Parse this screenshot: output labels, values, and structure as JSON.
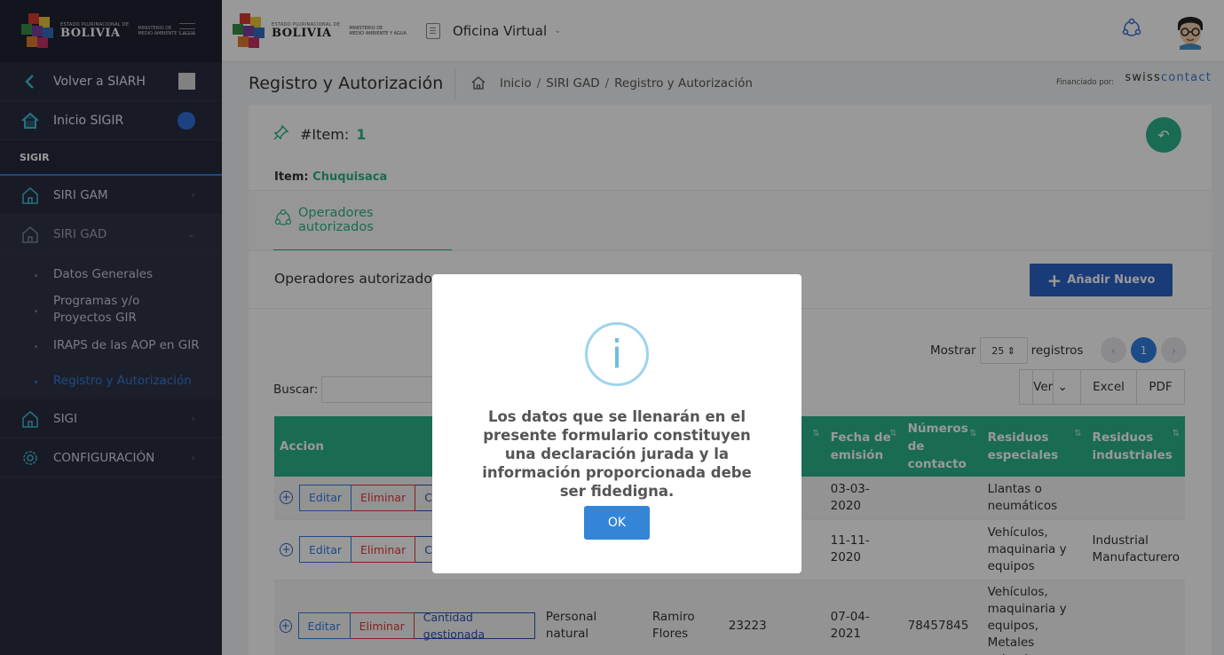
{
  "brand": {
    "state_small": "ESTADO PLURINACIONAL DE",
    "country": "BOLIVIA",
    "ministry_l1": "MINISTERIO DE",
    "ministry_l2": "MEDIO AMBIENTE Y AGUA"
  },
  "sidebar": {
    "back": "Volver a SIARH",
    "home": "Inicio SIGIR",
    "section": "SIGIR",
    "menu_gam": "SIRI GAM",
    "menu_gad": "SIRI GAD",
    "sub": [
      "Datos Generales",
      "Programas y/o Proyectos GIR",
      "IRAPS de las AOP en GIR",
      "Registro y Autorización"
    ],
    "menu_sigi": "SIGI",
    "menu_config": "CONFIGURACIÓN"
  },
  "topbar": {
    "app": "Oficina Virtual"
  },
  "breadcrumb": {
    "title": "Registro y Autorización",
    "items": [
      "Inicio",
      "SIRI GAD",
      "Registro y Autorización"
    ],
    "financed": "Financiado por:",
    "sponsor_a": "swiss",
    "sponsor_b": "contact"
  },
  "card": {
    "item_label": "#Item:",
    "item_number": "1",
    "item_prefix": "Item:",
    "item_name": "Chuquisaca",
    "tab": "Operadores autorizados",
    "section_title": "Operadores autorizados",
    "add_button": "Añadir Nuevo",
    "show_label": "Mostrar",
    "show_value": "25",
    "records_label": "registros",
    "page": "1",
    "search_label": "Buscar:",
    "btn_view": "Ver",
    "btn_excel": "Excel",
    "btn_pdf": "PDF"
  },
  "table": {
    "headers": {
      "accion": "Accion",
      "fecha": "Fecha de emisión",
      "numeros": "Números de contacto",
      "especiales": "Residuos especiales",
      "industriales": "Residuos industriales"
    },
    "btn_edit": "Editar",
    "btn_delete": "Eliminar",
    "btn_qty_short": "Ca",
    "btn_qty": "Cantidad gestionada",
    "rows": [
      {
        "fecha": "03-03-2020",
        "contacto": "",
        "especiales": "Llantas o neumáticos",
        "industriales": ""
      },
      {
        "fecha": "11-11-2020",
        "contacto": "",
        "especiales": "Vehículos, maquinaria y equipos",
        "industriales": "Industrial Manufacturero"
      },
      {
        "tipo": "Personal natural",
        "nombre": "Ramiro Flores",
        "codigo": "23223",
        "fecha": "07-04-2021",
        "contacto": "78457845",
        "especiales": "Vehículos, maquinaria y equipos, Metales voluminosos",
        "industriales": ""
      }
    ]
  },
  "modal": {
    "icon": "info-icon",
    "text": "Los datos que se llenarán en el presente formulario constituyen una declaración jurada y la información proporcionada debe ser fidedigna.",
    "ok": "OK"
  }
}
